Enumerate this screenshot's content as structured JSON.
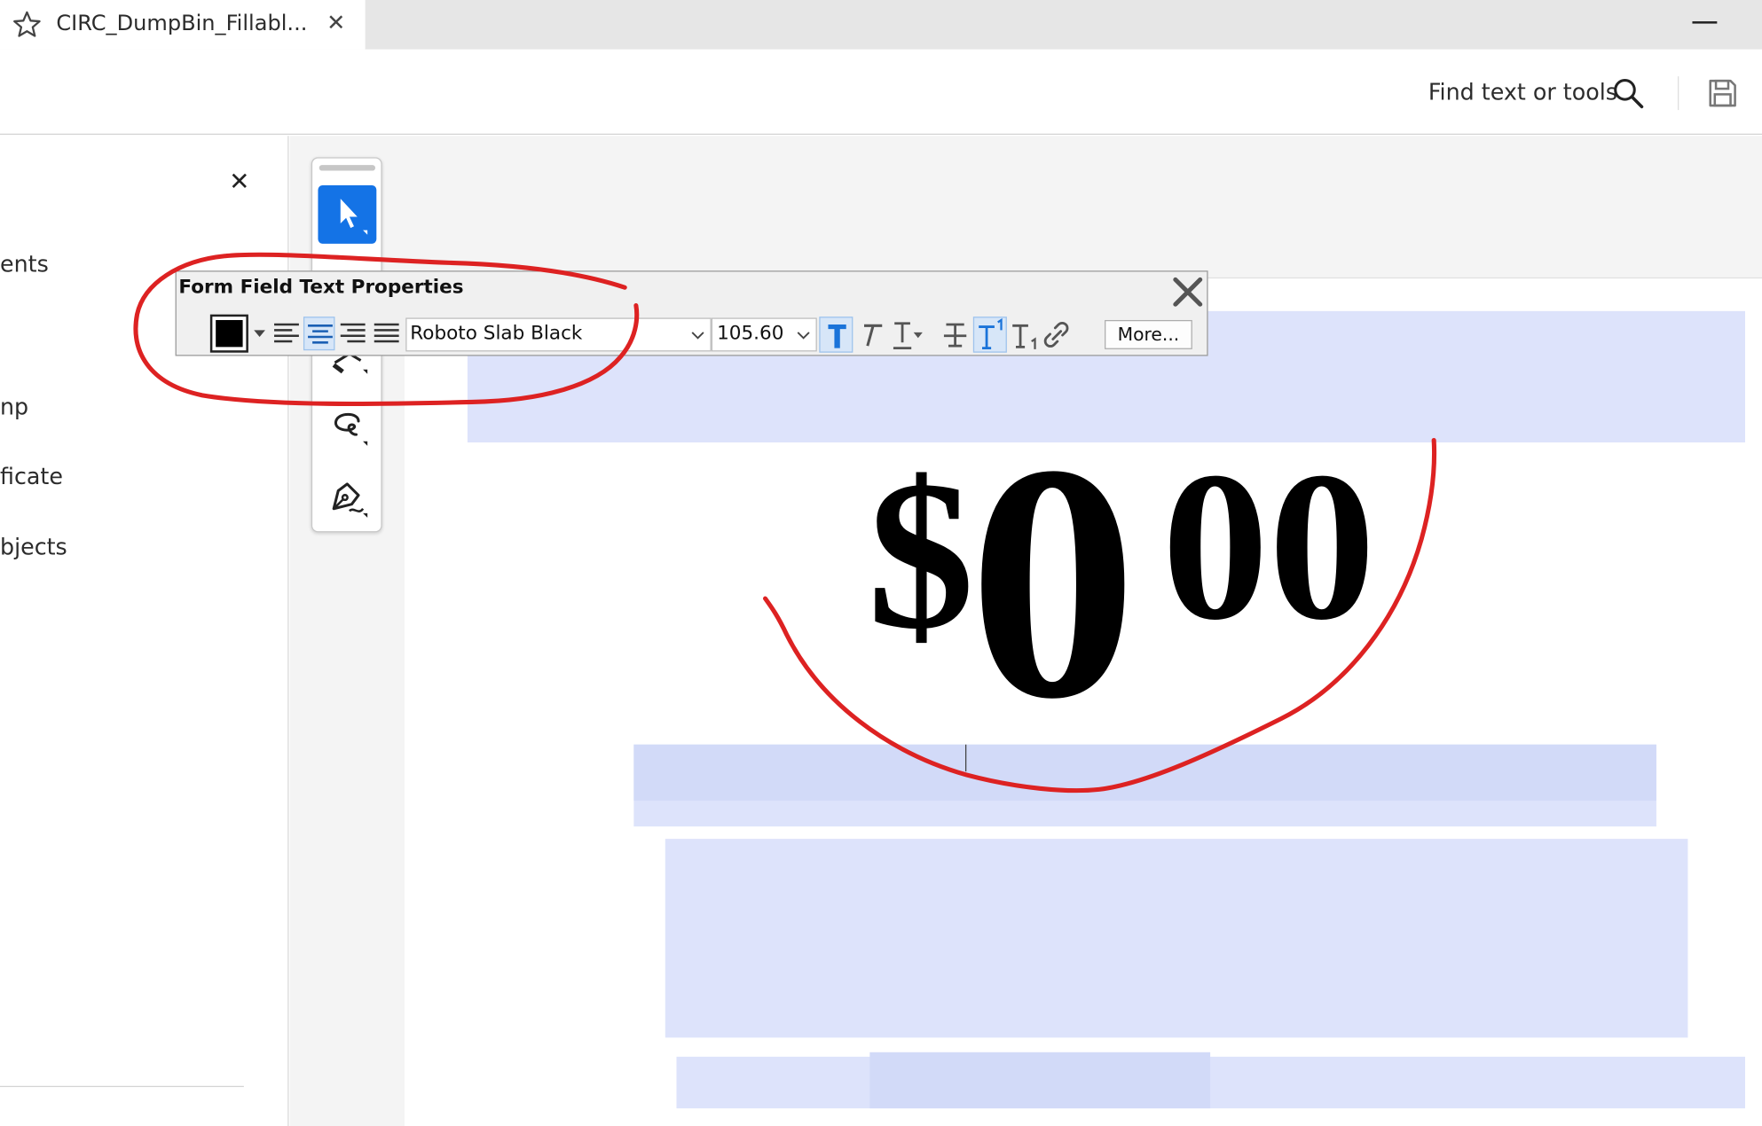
{
  "tab": {
    "title": "CIRC_DumpBin_Fillabl...",
    "close_label": "✕",
    "star_icon": "star-icon"
  },
  "window": {
    "minimize_icon": "minimize-icon"
  },
  "toolbar": {
    "find_label": "Find text or tools",
    "search_icon": "search-icon",
    "save_icon": "save-icon"
  },
  "left_panel": {
    "close_label": "✕",
    "items": [
      {
        "label": "ents"
      },
      {
        "label": "np"
      },
      {
        "label": "ficate"
      },
      {
        "label": "bjects"
      }
    ]
  },
  "tool_rail": {
    "tools": [
      {
        "name": "select-tool",
        "icon": "cursor-arrow-icon",
        "active": true
      },
      {
        "name": "highlight-tool",
        "icon": "highlighter-icon",
        "active": false
      },
      {
        "name": "draw-tool",
        "icon": "lasso-icon",
        "active": false
      },
      {
        "name": "sign-tool",
        "icon": "pen-sign-icon",
        "active": false
      }
    ]
  },
  "form_field_properties": {
    "title": "Form Field Text Properties",
    "text_color": "#000000",
    "alignment_options": [
      "left",
      "center",
      "right",
      "justify"
    ],
    "active_alignment": "center",
    "font_family": "Roboto Slab Black",
    "font_size": "105.60",
    "more_label": "More...",
    "format_buttons": [
      {
        "name": "bold",
        "icon": "bold-t-icon",
        "active": true
      },
      {
        "name": "italic",
        "icon": "italic-t-icon",
        "active": false
      },
      {
        "name": "underline",
        "icon": "underline-t-icon",
        "active": false
      },
      {
        "name": "strikethrough",
        "icon": "strikethrough-t-icon",
        "active": false
      },
      {
        "name": "superscript",
        "icon": "superscript-t-icon",
        "active": true
      },
      {
        "name": "subscript",
        "icon": "subscript-t-icon",
        "active": false
      },
      {
        "name": "link",
        "icon": "link-icon",
        "active": false
      }
    ]
  },
  "document": {
    "price": {
      "dollar": "$",
      "whole": "0",
      "cents": "00"
    },
    "field_color": "#dde3fb"
  },
  "annotation": {
    "color": "#dd2222"
  }
}
